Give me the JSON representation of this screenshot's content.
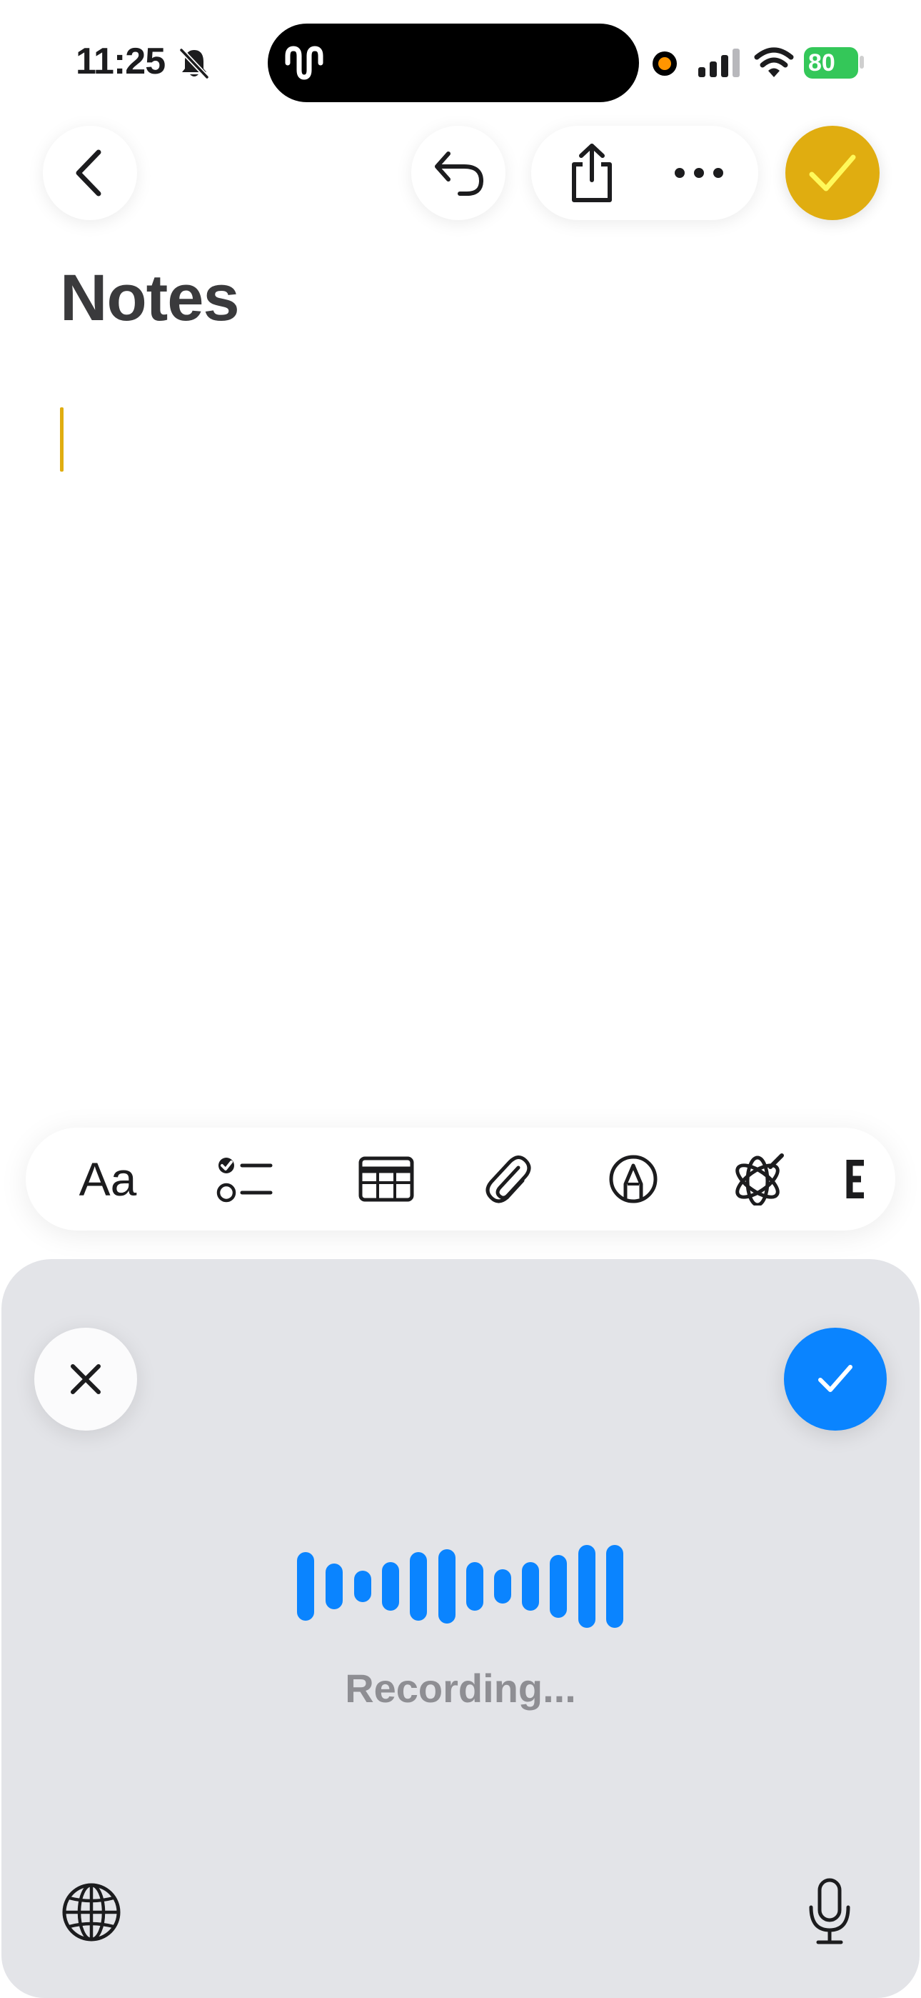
{
  "status_bar": {
    "time": "11:25",
    "battery": "80",
    "icons": [
      "bell-slash-icon",
      "waveform-icon",
      "recording-dot-icon",
      "cellular-icon",
      "wifi-icon",
      "battery-icon"
    ]
  },
  "toolbar": {
    "icons": [
      "chevron-left-icon",
      "undo-icon",
      "share-icon",
      "ellipsis-icon",
      "checkmark-icon"
    ],
    "accent_color": "#e0ad10"
  },
  "note": {
    "title": "Notes",
    "body": ""
  },
  "format_bar": {
    "text_style_label": "Aa",
    "icons": [
      "checklist-icon",
      "table-icon",
      "paperclip-icon",
      "markup-pen-icon",
      "apple-intelligence-icon",
      "more-truncated-icon"
    ]
  },
  "dictation": {
    "status": "Recording...",
    "accent_color": "#0a84ff",
    "icons": [
      "close-icon",
      "checkmark-icon",
      "globe-icon",
      "microphone-icon"
    ]
  }
}
